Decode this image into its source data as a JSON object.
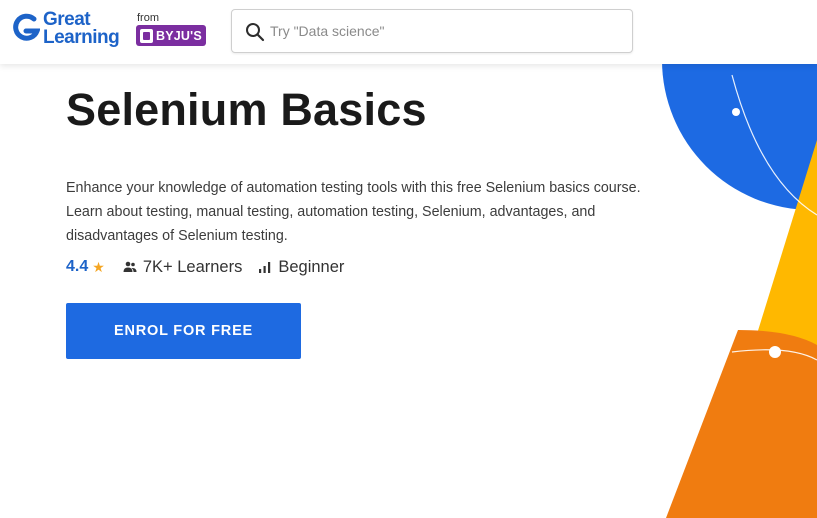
{
  "brand": {
    "logo_line1": "Great",
    "logo_line2": "Learning",
    "from_label": "from",
    "partner": "BYJU'S",
    "primary_color": "#1d63c8",
    "partner_color": "#7b2ea0"
  },
  "search": {
    "placeholder": "Try \"Data science\"",
    "icon": "search-icon"
  },
  "course": {
    "title": "Selenium Basics",
    "description": "Enhance your knowledge of automation testing tools with this free Selenium basics course. Learn about testing, manual testing, automation testing, Selenium, advantages, and disadvantages of Selenium testing.",
    "rating": "4.4",
    "star": "★",
    "learners": "7K+ Learners",
    "level": "Beginner",
    "cta_label": "ENROL FOR FREE",
    "cta_color": "#1e6ae1"
  },
  "decor_colors": {
    "blue": "#1d6ae3",
    "yellow": "#ffb800",
    "orange": "#f07c10"
  }
}
